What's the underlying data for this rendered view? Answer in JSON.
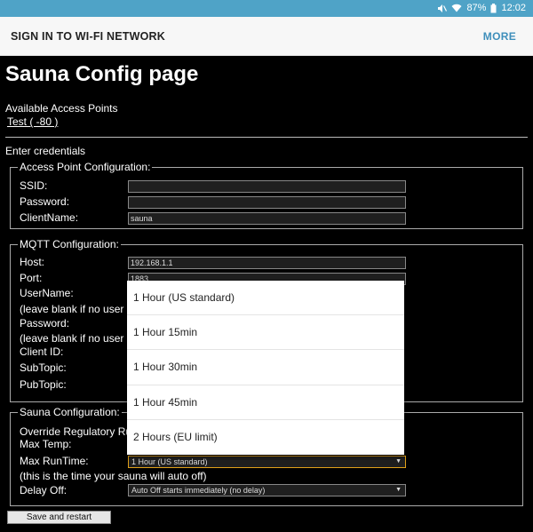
{
  "status_bar": {
    "battery": "87%",
    "time": "12:02",
    "mute_icon": "mute-icon",
    "wifi_icon": "wifi-icon",
    "battery_icon": "battery-icon"
  },
  "appbar": {
    "title": "SIGN IN TO WI-FI NETWORK",
    "more": "MORE"
  },
  "page": {
    "heading": "Sauna Config page",
    "access_points_label": "Available Access Points",
    "access_point_link": "Test  ( -80 )",
    "enter_credentials": "Enter credentials"
  },
  "ap_config": {
    "legend": "Access Point Configuration:",
    "ssid_label": "SSID:",
    "ssid_value": "",
    "password_label": "Password:",
    "password_value": "",
    "clientname_label": "ClientName:",
    "clientname_value": "sauna"
  },
  "mqtt_config": {
    "legend": "MQTT Configuration:",
    "host_label": "Host:",
    "host_value": "192.168.1.1",
    "port_label": "Port:",
    "port_value": "1883",
    "username_label": "UserName:",
    "username_note": "(leave blank if no user",
    "password_label": "Password:",
    "password_note": "(leave blank if no user",
    "clientid_label": "Client ID:",
    "subtopic_label": "SubTopic:",
    "pubtopic_label": "PubTopic:"
  },
  "sauna_config": {
    "legend": "Sauna Configuration:",
    "override_label": "Override Regulatory Ru",
    "maxtemp_label": "Max Temp:",
    "maxruntime_label": "Max RunTime:",
    "maxruntime_value": "1 Hour (US standard)",
    "runtime_note": "(this is the time your sauna will auto off)",
    "delayoff_label": "Delay Off:",
    "delayoff_value": "Auto Off starts immediately (no delay)"
  },
  "save_button": "Save and restart",
  "dropdown_options": [
    "1 Hour (US standard)",
    "1 Hour 15min",
    "1 Hour 30min",
    "1 Hour 45min",
    "2 Hours (EU limit)"
  ]
}
